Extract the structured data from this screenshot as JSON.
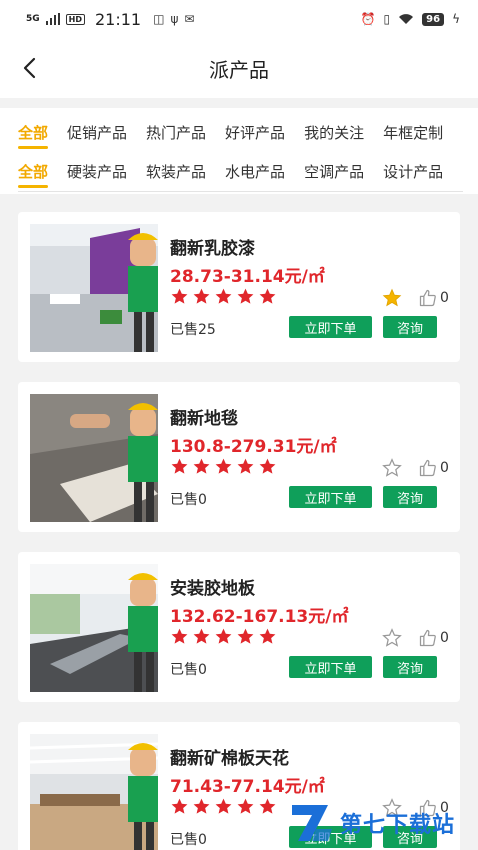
{
  "status_bar": {
    "network": "5G",
    "hd": "HD",
    "time": "21:11",
    "battery": "96"
  },
  "header": {
    "title": "派产品"
  },
  "category_tabs": [
    "全部",
    "促销产品",
    "热门产品",
    "好评产品",
    "我的关注",
    "年框定制"
  ],
  "type_tabs": [
    "全部",
    "硬装产品",
    "软装产品",
    "水电产品",
    "空调产品",
    "设计产品"
  ],
  "products": [
    {
      "name": "翻新乳胶漆",
      "price": "28.73-31.14元/㎡",
      "rating": 5,
      "favorited": true,
      "likes": "0",
      "sold": "已售25"
    },
    {
      "name": "翻新地毯",
      "price": "130.8-279.31元/㎡",
      "rating": 5,
      "favorited": false,
      "likes": "0",
      "sold": "已售0"
    },
    {
      "name": "安装胶地板",
      "price": "132.62-167.13元/㎡",
      "rating": 5,
      "favorited": false,
      "likes": "0",
      "sold": "已售0"
    },
    {
      "name": "翻新矿棉板天花",
      "price": "71.43-77.14元/㎡",
      "rating": 5,
      "favorited": false,
      "likes": "0",
      "sold": "已售0"
    }
  ],
  "buttons": {
    "order": "立即下单",
    "consult": "咨询"
  },
  "watermark": {
    "text": "第七下载站"
  },
  "colors": {
    "accent": "#f5b400",
    "price": "#e0262b",
    "button": "#0f9f5a",
    "star": "#e0262b",
    "favorite": "#f5b400"
  }
}
